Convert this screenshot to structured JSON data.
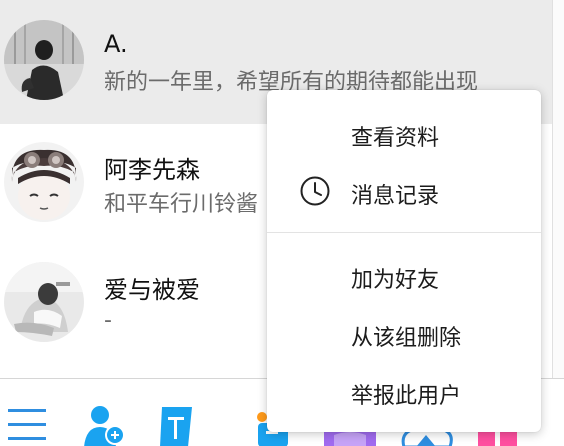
{
  "contacts": [
    {
      "name": "A.",
      "message": "新的一年里，希望所有的期待都能出现"
    },
    {
      "name": "阿李先森",
      "message": "和平车行川铃酱"
    },
    {
      "name": "爱与被爱",
      "message": "-"
    }
  ],
  "context_menu": {
    "items": [
      {
        "label": "查看资料"
      },
      {
        "label": "消息记录",
        "icon": "clock-icon"
      },
      {
        "label": "加为好友"
      },
      {
        "label": "从该组删除"
      },
      {
        "label": "举报此用户"
      }
    ]
  },
  "tabbar": {
    "icons": [
      "menu-icon",
      "add-contact-icon",
      "transfer-icon",
      "game-icon",
      "pen-icon",
      "cloud-icon",
      "apps-icon"
    ]
  },
  "colors": {
    "selected_row": "#ebebeb",
    "accent_blue": "#1aa3f0",
    "accent_orange": "#ff9a1a",
    "accent_pink": "#ff4fa0",
    "accent_purple": "#a16bf0"
  }
}
